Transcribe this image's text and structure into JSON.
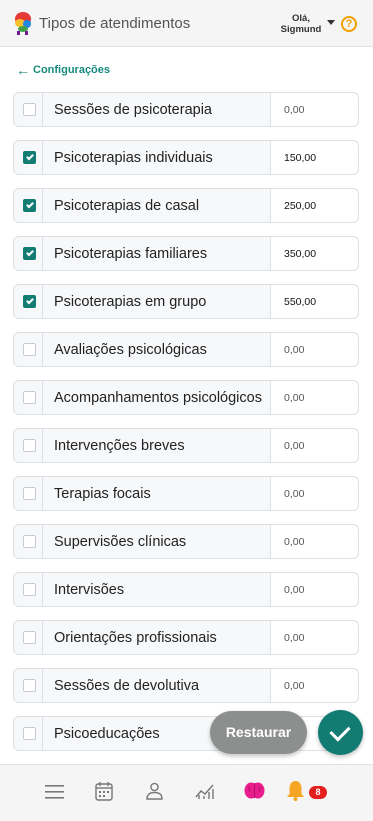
{
  "header": {
    "title": "Tipos de atendimentos",
    "greeting_line1": "Olá,",
    "greeting_line2": "Sigmund",
    "help_icon": "?"
  },
  "back_link": {
    "label": "Configurações"
  },
  "items": [
    {
      "label": "Sessões de psicoterapia",
      "value": "0,00",
      "checked": false
    },
    {
      "label": "Psicoterapias individuais",
      "value": "150,00",
      "checked": true
    },
    {
      "label": "Psicoterapias de casal",
      "value": "250,00",
      "checked": true
    },
    {
      "label": "Psicoterapias familiares",
      "value": "350,00",
      "checked": true
    },
    {
      "label": "Psicoterapias em grupo",
      "value": "550,00",
      "checked": true
    },
    {
      "label": "Avaliações psicológicas",
      "value": "0,00",
      "checked": false
    },
    {
      "label": "Acompanhamentos psicológicos",
      "value": "0,00",
      "checked": false
    },
    {
      "label": "Intervenções breves",
      "value": "0,00",
      "checked": false
    },
    {
      "label": "Terapias focais",
      "value": "0,00",
      "checked": false
    },
    {
      "label": "Supervisões clínicas",
      "value": "0,00",
      "checked": false
    },
    {
      "label": "Intervisões",
      "value": "0,00",
      "checked": false
    },
    {
      "label": "Orientações profissionais",
      "value": "0,00",
      "checked": false
    },
    {
      "label": "Sessões de devolutiva",
      "value": "0,00",
      "checked": false
    },
    {
      "label": "Psicoeducações",
      "value": "",
      "checked": false
    }
  ],
  "actions": {
    "restore_label": "Restaurar"
  },
  "bottom_nav": {
    "items": [
      "menu-icon",
      "calendar-icon",
      "user-icon",
      "chart-icon",
      "brain-icon",
      "bell-icon"
    ],
    "notification_count": "8"
  },
  "colors": {
    "accent": "#137c72",
    "link": "#168a7e",
    "help": "#f0a000",
    "badge": "#e41d1d"
  }
}
